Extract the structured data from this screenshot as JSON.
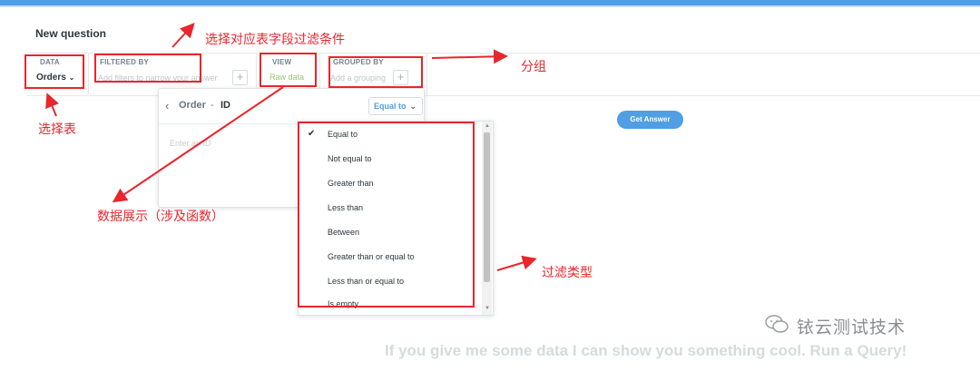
{
  "page": {
    "title": "New question"
  },
  "query_builder": {
    "data": {
      "label": "DATA",
      "value": "Orders",
      "chevron": "chevron-down-icon"
    },
    "filtered_by": {
      "label": "FILTERED BY",
      "placeholder": "Add filters to narrow your answer",
      "add_icon": "+"
    },
    "view": {
      "label": "VIEW",
      "value": "Raw data"
    },
    "grouped_by": {
      "label": "GROUPED BY",
      "placeholder": "Add a grouping",
      "add_icon": "+"
    }
  },
  "filter_popover": {
    "back_icon": "chevron-left-icon",
    "table": "Order",
    "separator": "-",
    "field": "ID",
    "operator_selected": "Equal to",
    "input_placeholder": "Enter an ID"
  },
  "operator_menu": {
    "check_glyph": "✔",
    "options": [
      {
        "label": "Equal to",
        "selected": true
      },
      {
        "label": "Not equal to",
        "selected": false
      },
      {
        "label": "Greater than",
        "selected": false
      },
      {
        "label": "Less than",
        "selected": false
      },
      {
        "label": "Between",
        "selected": false
      },
      {
        "label": "Greater than or equal to",
        "selected": false
      },
      {
        "label": "Less than or equal to",
        "selected": false
      },
      {
        "label": "Is empty",
        "selected": false
      }
    ]
  },
  "actions": {
    "get_answer": "Get Answer"
  },
  "empty_state": {
    "message": "If you give me some data I can show you something cool. Run a Query!"
  },
  "annotations": {
    "select_table": "选择表",
    "select_filter": "选择对应表字段过滤条件",
    "grouping": "分组",
    "data_display": "数据展示（涉及函数）",
    "filter_type": "过滤类型",
    "color": "#e8262b"
  },
  "watermark": {
    "text": "铱云测试技术",
    "icon": "wechat-icon"
  },
  "colors": {
    "brand_blue": "#509ee3",
    "annotation_red": "#e8262b",
    "raw_data_green": "#9cc177"
  }
}
